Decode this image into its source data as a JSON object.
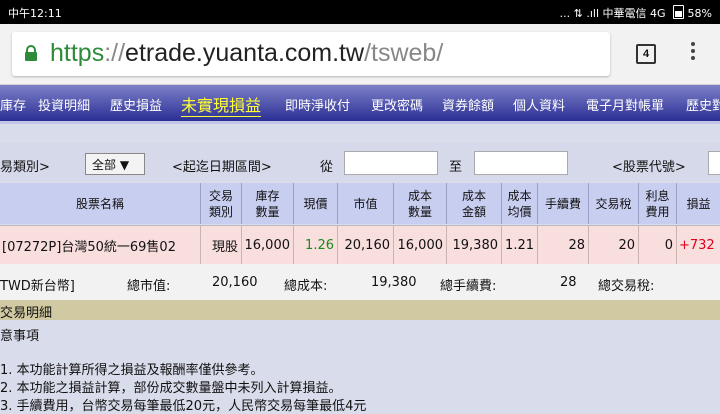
{
  "status_bar": {
    "time": "中午12:11",
    "network": "... ⇅ .ıll",
    "carrier": "中華電信",
    "signal": "4G",
    "battery": "58%"
  },
  "browser": {
    "url_scheme": "https",
    "url_sep": "://",
    "url_host": "etrade.yuanta.com.tw",
    "url_path": "/tsweb/",
    "tab_count": "4"
  },
  "nav": {
    "items": [
      "庫存",
      "投資明細",
      "歷史損益",
      "未實現損益",
      "即時淨收付",
      "更改密碼",
      "資券餘額",
      "個人資料",
      "電子月對帳單",
      "歷史對"
    ],
    "active_index": 3
  },
  "filter": {
    "trade_type_label": "易類別>",
    "trade_type_value": "全部 ▼",
    "date_range_label": "<起迄日期區間>",
    "from_label": "從",
    "to_label": "至",
    "stock_code_label": "<股票代號>"
  },
  "table": {
    "headers": [
      "股票名稱",
      "交易\n類別",
      "庫存\n數量",
      "現價",
      "市值",
      "成本\n數量",
      "成本\n金額",
      "成本\n均價",
      "手續費",
      "交易稅",
      "利息\n費用",
      "損益"
    ],
    "row": {
      "name": "[07272P]台灣50統一69售02",
      "type": "現股",
      "qty": "16,000",
      "price": "1.26",
      "market_value": "20,160",
      "cost_qty": "16,000",
      "cost_amount": "19,380",
      "avg_cost": "1.21",
      "fee": "28",
      "tax": "20",
      "interest": "0",
      "pnl": "+732"
    }
  },
  "summary": {
    "currency": "TWD新台幣]",
    "market_value_label": "總市值:",
    "market_value": "20,160",
    "cost_label": "總成本:",
    "cost": "19,380",
    "fee_label": "總手續費:",
    "fee": "28",
    "tax_label": "總交易稅:"
  },
  "section": {
    "title": "交易明細"
  },
  "notes": {
    "heading": "意事項",
    "lines": [
      "1. 本功能計算所得之損益及報酬率僅供參考。",
      "2. 本功能之損益計算，部份成交數量盤中未列入計算損益。",
      "3. 手續費用，台幣交易每筆最低20元，人民幣交易每筆最低4元"
    ]
  },
  "colors": {
    "nav_gradient_top": "#7d80c8",
    "nav_gradient_bottom": "#2b2f95",
    "nav_active": "#ffff33",
    "price_green": "#1a8a1a",
    "pnl_red": "#e0001a",
    "url_scheme_green": "#2e8b3a",
    "row_bg": "#f9dede",
    "header_bg": "#c8cef0"
  }
}
